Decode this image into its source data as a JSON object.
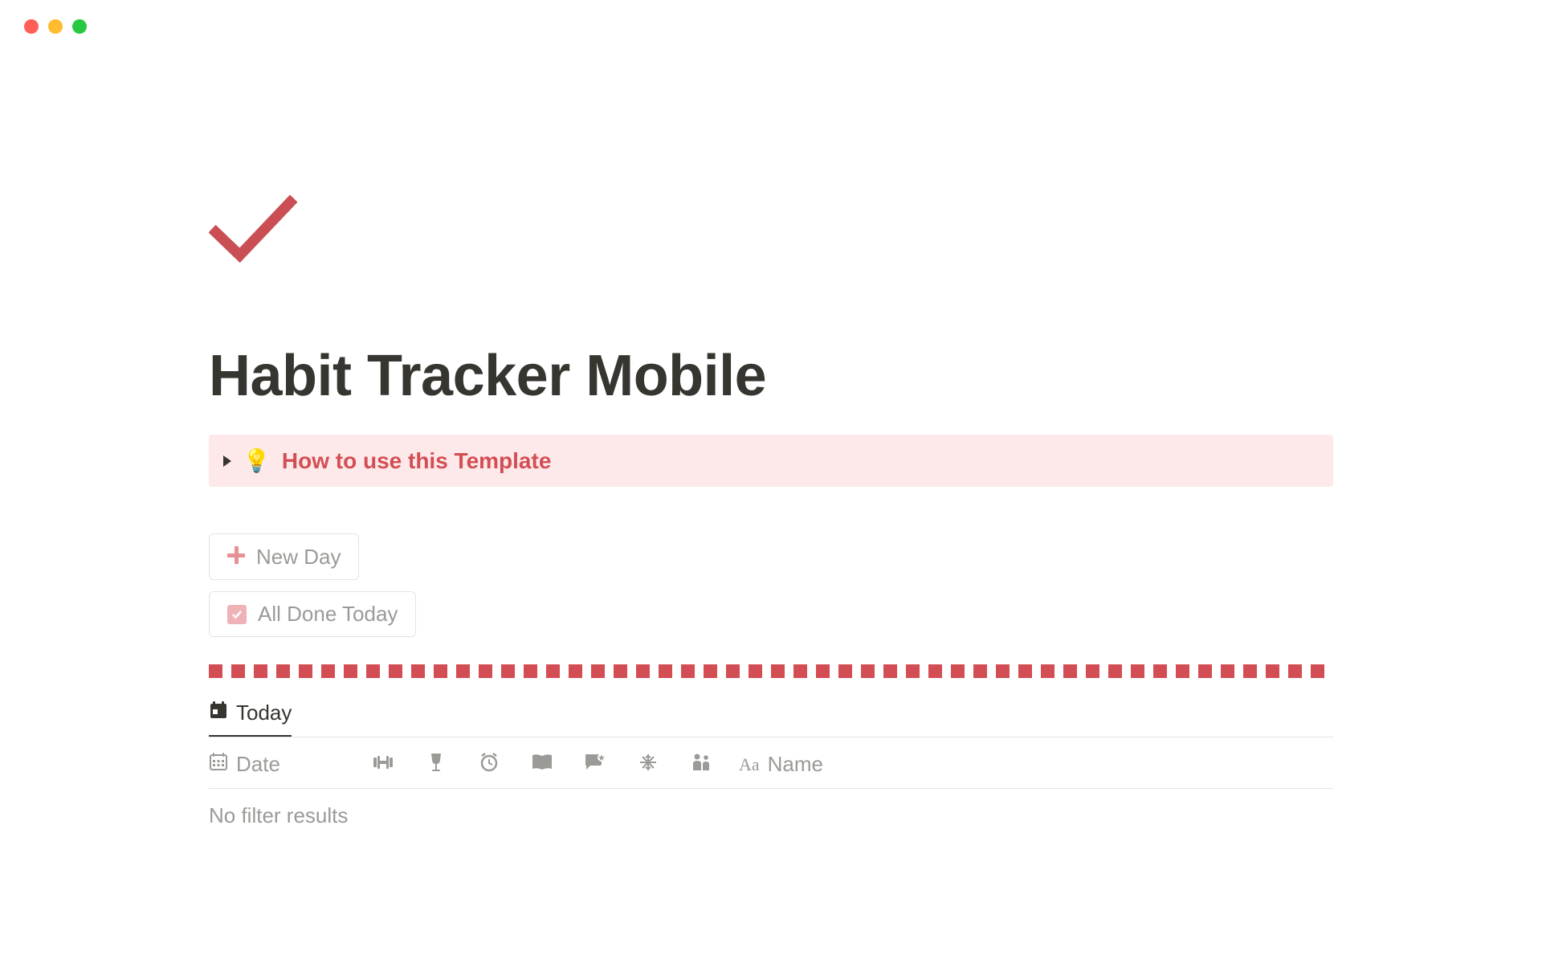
{
  "window": {
    "controls": [
      "close",
      "minimize",
      "maximize"
    ]
  },
  "page": {
    "title": "Habit Tracker Mobile"
  },
  "callout": {
    "bulb": "💡",
    "text": "How to use this Template"
  },
  "actions": {
    "new_day_label": "New Day",
    "all_done_label": "All Done Today"
  },
  "tabs": {
    "active_label": "Today"
  },
  "table": {
    "columns": {
      "date": "Date",
      "name": "Name"
    },
    "habit_icons": [
      "dumbbell",
      "wine-glass",
      "alarm-clock",
      "book",
      "chat-star",
      "snowflake",
      "people"
    ],
    "empty_text": "No filter results"
  }
}
